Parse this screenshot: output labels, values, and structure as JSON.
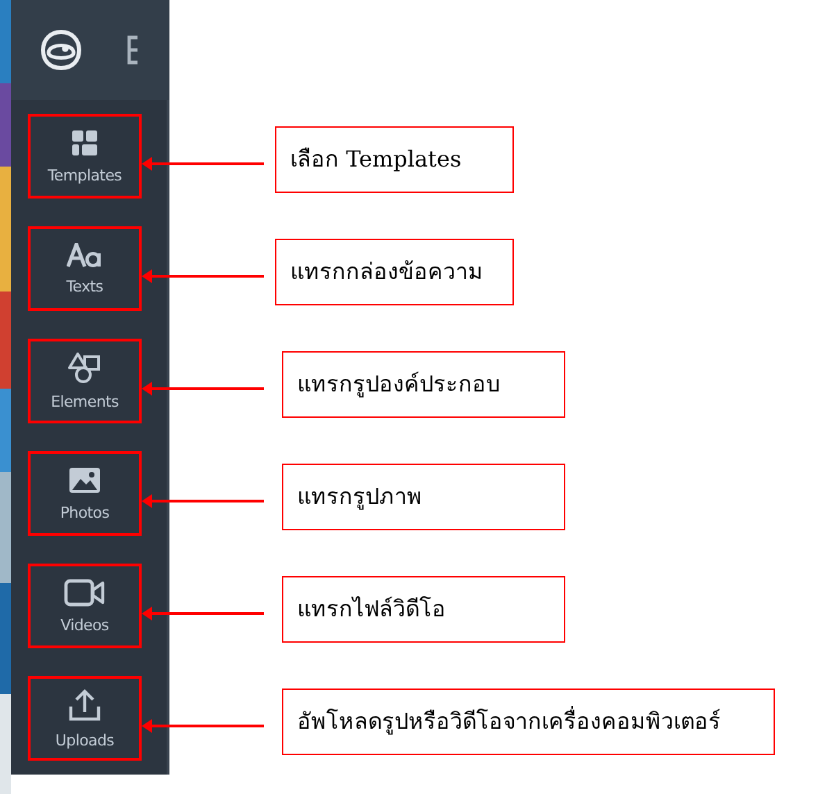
{
  "sidebar": {
    "items": [
      {
        "label": "Templates",
        "note": "เลือก Templates"
      },
      {
        "label": "Texts",
        "note": "แทรกกล่องข้อความ"
      },
      {
        "label": "Elements",
        "note": "แทรกรูปองค์ประกอบ"
      },
      {
        "label": "Photos",
        "note": "แทรกรูปภาพ"
      },
      {
        "label": "Videos",
        "note": "แทรกไฟล์วิดีโอ"
      },
      {
        "label": "Uploads",
        "note": "อัพโหลดรูปหรือวิดีโอจากเครื่องคอมพิวเตอร์"
      }
    ]
  }
}
